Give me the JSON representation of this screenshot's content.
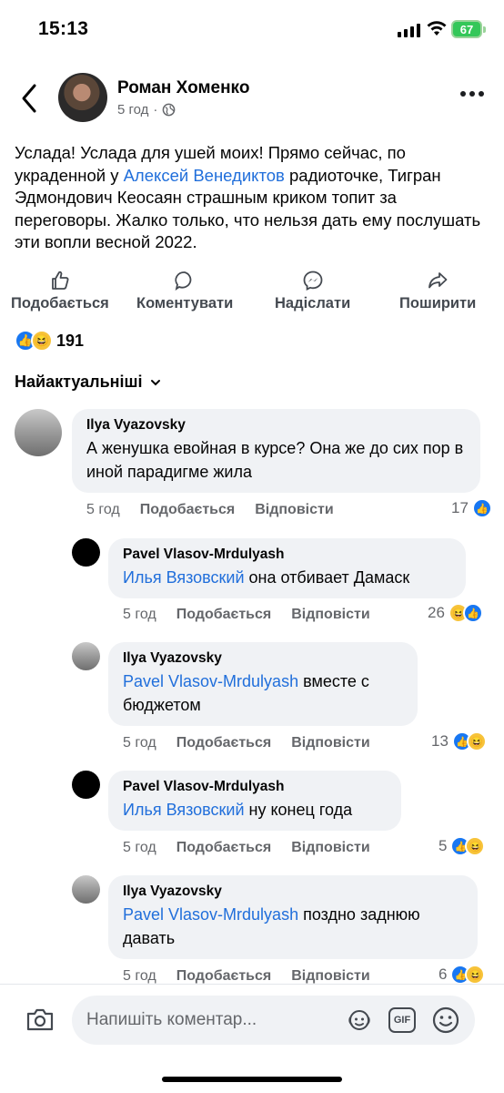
{
  "status_bar": {
    "time": "15:13",
    "battery": "67"
  },
  "post": {
    "author": "Роман Хоменко",
    "time": "5 год",
    "text_before": "Услада! Услада для ушей моих! Прямо сейчас, по украденной у ",
    "mention": "Алексей Венедиктов",
    "text_after": " радиоточке, Тигран Эдмондович Кеосаян страшным криком топит за переговоры. Жалко только, что нельзя дать ему послушать эти вопли весной 2022."
  },
  "actions": {
    "like": "Подобається",
    "comment": "Коментувати",
    "send": "Надіслати",
    "share": "Поширити"
  },
  "reactions_count": "191",
  "sort_label": "Найактуальніші",
  "comments": [
    {
      "name": "Ilya Vyazovsky",
      "mention": "",
      "text": "А женушка евойная в курсе? Она же до сих пор в иной парадигме жила",
      "time": "5 год",
      "like": "Подобається",
      "reply": "Відповісти",
      "count": "17"
    },
    {
      "name": "Pavel Vlasov-Mrdulyash",
      "mention": "Илья Вязовский",
      "text": " она отбивает Дамаск",
      "time": "5 год",
      "like": "Подобається",
      "reply": "Відповісти",
      "count": "26"
    },
    {
      "name": "Ilya Vyazovsky",
      "mention": "Pavel Vlasov-Mrdulyash",
      "text": " вместе с бюджетом",
      "time": "5 год",
      "like": "Подобається",
      "reply": "Відповісти",
      "count": "13"
    },
    {
      "name": "Pavel Vlasov-Mrdulyash",
      "mention": "Илья Вязовский",
      "text": " ну конец года",
      "time": "5 год",
      "like": "Подобається",
      "reply": "Відповісти",
      "count": "5"
    },
    {
      "name": "Ilya Vyazovsky",
      "mention": "Pavel Vlasov-Mrdulyash",
      "text": " поздно заднюю давать",
      "time": "5 год",
      "like": "Подобається",
      "reply": "Відповісти",
      "count": "6"
    }
  ],
  "composer": {
    "placeholder": "Напишіть коментар..."
  },
  "colors": {
    "mention": "#216fdb",
    "like": "#1877f2",
    "bubble": "#f0f2f5"
  }
}
